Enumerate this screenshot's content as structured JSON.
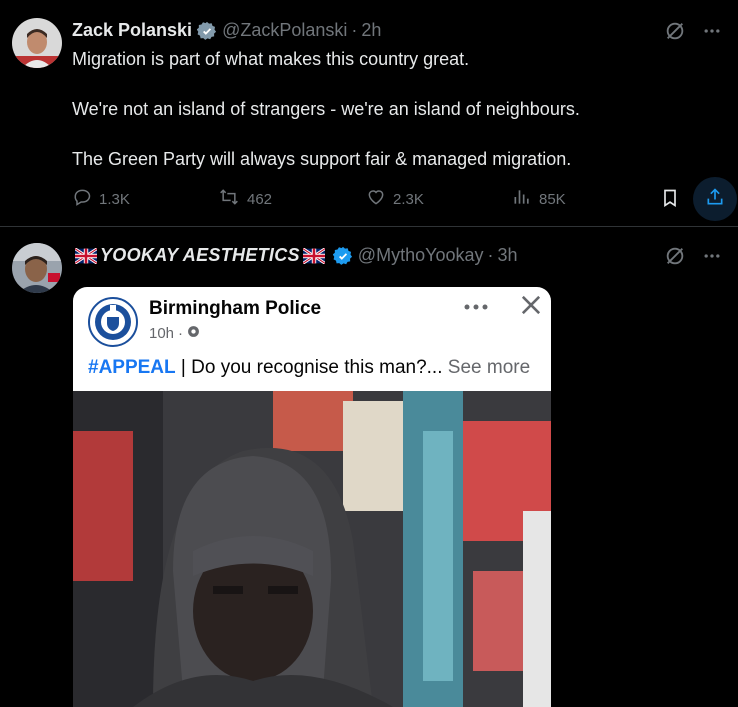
{
  "tweets": [
    {
      "name": "Zack Polanski",
      "handle": "@ZackPolanski",
      "time": "2h",
      "text": [
        "Migration is part of what makes this country great.",
        "We're not an island of strangers - we're an island of neighbours.",
        "The Green Party will always support fair & managed migration."
      ],
      "stats": {
        "replies": "1.3K",
        "reposts": "462",
        "likes": "2.3K",
        "views": "85K"
      }
    },
    {
      "name": "YOOKAY AESTHETICS",
      "handle": "@MythoYookay",
      "time": "3h",
      "embed": {
        "page_name": "Birmingham Police",
        "meta_time": "10h",
        "hashtag": "#APPEAL",
        "separator": " | ",
        "text": "Do you recognise this man?...",
        "see_more": " See more"
      }
    }
  ],
  "colors": {
    "background": "#000000",
    "text": "#e7e9ea",
    "secondary": "#71767b",
    "verified": "#1d9bf0",
    "hashtag": "#1877f2"
  },
  "icons": [
    "verified-badge-icon",
    "grok-icon",
    "more-icon",
    "reply-icon",
    "repost-icon",
    "like-icon",
    "views-icon",
    "bookmark-icon",
    "share-icon",
    "uk-flag-icon",
    "close-icon",
    "globe-icon"
  ]
}
